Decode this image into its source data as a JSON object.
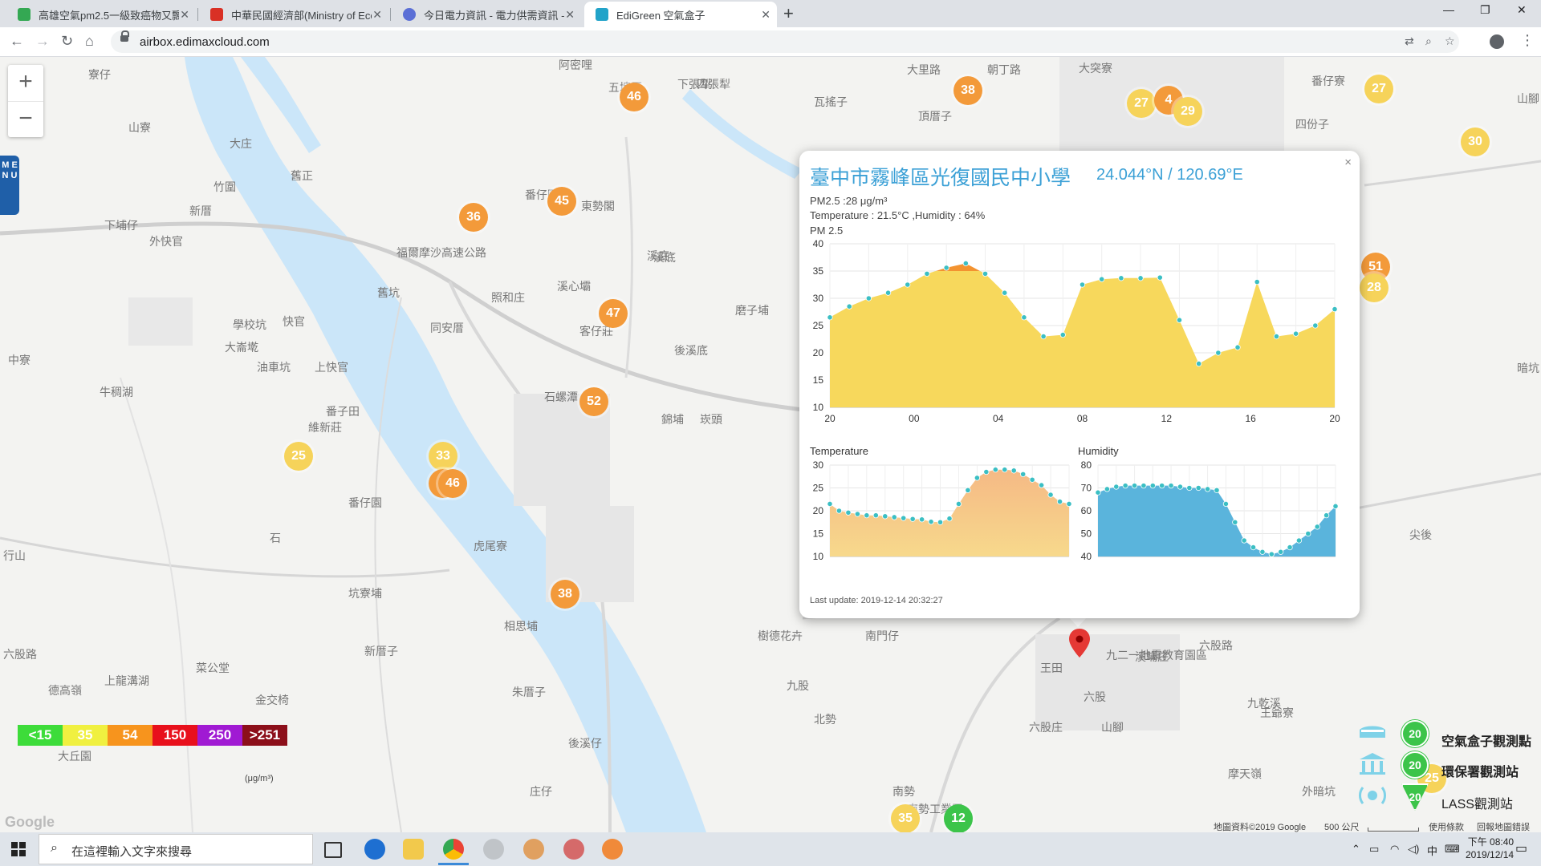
{
  "browser": {
    "tabs": [
      {
        "title": "高雄空氣pm2.5一級致癌物又飄...",
        "favicon": "green"
      },
      {
        "title": "中華民國經濟部(Ministry of Econ...",
        "favicon": "red"
      },
      {
        "title": "今日電力資訊 - 電力供需資訊 - 台...",
        "favicon": "blue"
      },
      {
        "title": "EdiGreen 空氣盒子",
        "favicon": "teal",
        "active": true
      }
    ],
    "url": "airbox.edimaxcloud.com"
  },
  "map": {
    "menu_label": "M E N U",
    "zoom_in": "+",
    "zoom_out": "−",
    "place_labels": [
      "寮仔",
      "山寮",
      "大庄",
      "竹圍",
      "新厝",
      "下埔仔",
      "外快官",
      "學校坑",
      "大崙墘",
      "油車坑",
      "上快官",
      "快官",
      "中寮",
      "牛稠湖",
      "番子田",
      "維新莊",
      "坑寮埔",
      "新厝子",
      "菜公堂",
      "金交椅",
      "上龍溝湖",
      "德高嶺",
      "大丘園",
      "六股路",
      "行山",
      "同安厝",
      "照和庄",
      "溪心壩",
      "番仔園",
      "東勢閣",
      "客仔莊",
      "石螺潭",
      "溪底",
      "後溪底",
      "磨子埔",
      "錦埔",
      "崁頭",
      "阿密哩",
      "五塊厝",
      "下張犁",
      "瓦搖子",
      "頂厝子",
      "大突寮",
      "番仔寮",
      "四份子",
      "山腳",
      "暗坑",
      "尖後",
      "王爺寮",
      "摩天嶺",
      "外暗坑",
      "樹德花卉",
      "南門仔",
      "九股",
      "北勢",
      "六股庄",
      "山腳",
      "六股",
      "王田",
      "六股路",
      "相思埔",
      "朱厝子",
      "後溪仔",
      "庄仔",
      "南勢工業區",
      "溪底",
      "九二一地震教育園區",
      "石",
      "番仔園",
      "虎尾寮",
      "大里路",
      "朝丁路",
      "福爾摩沙高速公路",
      "舊正",
      "舊坑",
      "溪埔庄",
      "九乾溪",
      "四張犁",
      "南勢"
    ],
    "markers": [
      {
        "value": "46",
        "level": "orange"
      },
      {
        "value": "38",
        "level": "orange"
      },
      {
        "value": "27",
        "level": "yellow"
      },
      {
        "value": "4",
        "level": "orange"
      },
      {
        "value": "29",
        "level": "yellow"
      },
      {
        "value": "27",
        "level": "yellow"
      },
      {
        "value": "30",
        "level": "yellow"
      },
      {
        "value": "51",
        "level": "orange"
      },
      {
        "value": "28",
        "level": "yellow"
      },
      {
        "value": "45",
        "level": "orange"
      },
      {
        "value": "36",
        "level": "orange"
      },
      {
        "value": "47",
        "level": "orange"
      },
      {
        "value": "52",
        "level": "orange"
      },
      {
        "value": "33",
        "level": "yellow"
      },
      {
        "value": "4",
        "level": "orange"
      },
      {
        "value": "46",
        "level": "orange"
      },
      {
        "value": "25",
        "level": "yellow"
      },
      {
        "value": "38",
        "level": "orange"
      },
      {
        "value": "28",
        "level": "yellow"
      },
      {
        "value": "25",
        "level": "yellow"
      },
      {
        "value": "35",
        "level": "yellow"
      },
      {
        "value": "12",
        "level": "green"
      },
      {
        "value": "25",
        "level": "yellow"
      }
    ],
    "legend": {
      "unit": "(μg/m³)",
      "items": [
        {
          "label": "<15",
          "color": "#3ddc3a"
        },
        {
          "label": "35",
          "color": "#f0f040"
        },
        {
          "label": "54",
          "color": "#f7941d"
        },
        {
          "label": "150",
          "color": "#e8101c"
        },
        {
          "label": "250",
          "color": "#a01ad3"
        },
        {
          "label": ">251",
          "color": "#8c0f1a"
        }
      ]
    },
    "station_legend": [
      {
        "label": "空氣盒子觀測點",
        "badge": "20",
        "icon": "airbox-icon"
      },
      {
        "label": "環保署觀測站",
        "badge": "20",
        "icon": "epa-station-icon"
      },
      {
        "label": "LASS觀測站",
        "badge": "20",
        "icon": "lass-station-icon"
      }
    ],
    "attribution": {
      "google": "Google",
      "data": "地圖資料©2019 Google",
      "scale": "500 公尺",
      "terms": "使用條款",
      "report": "回報地圖錯誤"
    }
  },
  "popup": {
    "title": "臺中市霧峰區光復國民中小學",
    "coord": "24.044°N / 120.69°E",
    "pm25_line": "PM2.5 :28 μg/m³",
    "env_line": "Temperature : 21.5°C ,Humidity : 64%",
    "chart_label": "PM 2.5",
    "temp_label": "Temperature",
    "hum_label": "Humidity",
    "last_update": "Last update: 2019-12-14 20:32:27",
    "close": "×"
  },
  "chart_data": [
    {
      "type": "area",
      "title": "PM 2.5",
      "x_ticks": [
        "20",
        "00",
        "04",
        "08",
        "12",
        "16",
        "20"
      ],
      "y_ticks": [
        10,
        15,
        20,
        25,
        30,
        35,
        40
      ],
      "ylim": [
        10,
        40
      ],
      "threshold": 35,
      "values": [
        26.5,
        28.5,
        30,
        31,
        32.5,
        34.5,
        35.6,
        36.4,
        34.5,
        31,
        26.5,
        23,
        23.3,
        32.5,
        33.5,
        33.7,
        33.7,
        33.8,
        26,
        18,
        20,
        21,
        33,
        23,
        23.5,
        25,
        28
      ],
      "colors": {
        "low": "#f7d85c",
        "high": "#f39330",
        "point": "#3bbfc4"
      }
    },
    {
      "type": "area",
      "title": "Temperature",
      "y_ticks": [
        10,
        15,
        20,
        25,
        30
      ],
      "ylim": [
        10,
        30
      ],
      "values": [
        21.5,
        20,
        19.6,
        19.3,
        19,
        19,
        18.8,
        18.6,
        18.4,
        18.2,
        18.1,
        17.6,
        17.5,
        18.3,
        21.5,
        24.5,
        27.2,
        28.5,
        29,
        29,
        28.8,
        28,
        26.8,
        25.6,
        23.5,
        22,
        21.5
      ],
      "colors": {
        "top": "#f5b985",
        "bottom": "#f7d98c",
        "point": "#3bbfc4"
      }
    },
    {
      "type": "area",
      "title": "Humidity",
      "y_ticks": [
        40,
        50,
        60,
        70,
        80
      ],
      "ylim": [
        40,
        80
      ],
      "values": [
        68,
        69.5,
        70.5,
        71,
        71,
        71,
        71,
        71,
        71,
        70.5,
        70,
        70,
        69.5,
        69,
        63,
        55,
        47,
        44,
        42,
        41,
        42,
        44,
        47,
        50,
        53,
        58,
        62
      ],
      "colors": {
        "fill": "#5ab4dc",
        "point": "#3bbfc4"
      }
    }
  ],
  "taskbar": {
    "search_placeholder": "在這裡輸入文字來搜尋",
    "time": "下午 08:40",
    "date": "2019/12/14",
    "ime": "中"
  }
}
